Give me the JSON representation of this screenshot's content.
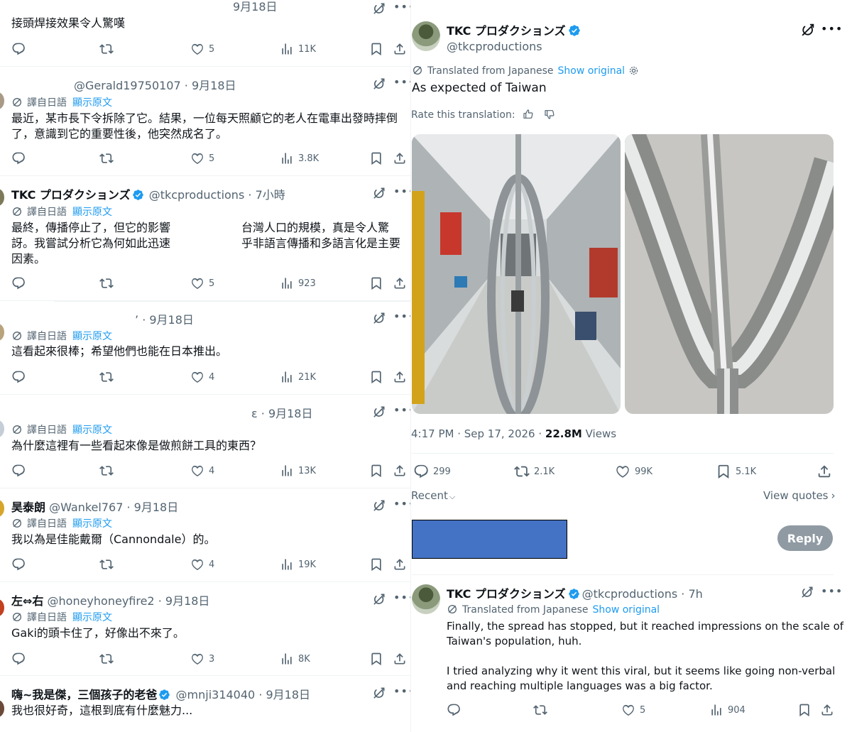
{
  "left": {
    "tweets": [
      {
        "date_fragment": "9月18日",
        "text": "接頭焊接效果令人驚嘆",
        "likes": "5",
        "views": "11K"
      },
      {
        "handle": "@Gerald19750107",
        "sep": "·",
        "date": "9月18日",
        "translated_from": "譯自日語",
        "show_original": "顯示原文",
        "text": "最近，某市長下令拆除了它。結果，一位每天照顧它的老人在電車出發時摔倒\n了，意識到它的重要性後，他突然成名了。",
        "likes": "5",
        "views": "3.8K"
      },
      {
        "name": "TKC プロダクションズ",
        "handle": "@tkcproductions",
        "sep": "·",
        "date": "7小時",
        "translated_from": "譯自日語",
        "show_original": "顯示原文",
        "text_a": "最終，傳播停止了，但它的影響\n訝。我嘗試分析它為何如此迅速\n因素。",
        "text_b": "台灣人口的規模，真是令人驚\n乎非語言傳播和多語言化是主要",
        "likes": "5",
        "views": "923"
      },
      {
        "handle_fragment": "’",
        "sep": "·",
        "date": "9月18日",
        "translated_from": "譯自日語",
        "show_original": "顯示原文",
        "text": "這看起來很棒；希望他們也能在日本推出。",
        "likes": "4",
        "views": "21K"
      },
      {
        "handle_fragment": "ɛ",
        "sep": "·",
        "date": "9月18日",
        "translated_from": "譯自日語",
        "show_original": "顯示原文",
        "text": "為什麼這裡有一些看起來像是做煎餅工具的東西？",
        "likes": "4",
        "views": "13K"
      },
      {
        "name": "昊泰朗",
        "handle": "@Wankel767",
        "sep": "·",
        "date": "9月18日",
        "translated_from": "譯自日語",
        "show_original": "顯示原文",
        "text": "我以為是佳能戴爾（Cannondale）的。",
        "likes": "4",
        "views": "19K"
      },
      {
        "name": "左⇔右",
        "handle": "@honeyhoneyfire2",
        "sep": "·",
        "date": "9月18日",
        "translated_from": "譯自日語",
        "show_original": "顯示原文",
        "text": "Gaki的頭卡住了，好像出不來了。",
        "likes": "3",
        "views": "8K"
      },
      {
        "name": "嗨~我是傑，三個孩子的老爸",
        "handle": "@mnji314040",
        "sep": "·",
        "date": "9月18日",
        "text": "我也很好奇，這根到底有什麼魅力..."
      }
    ]
  },
  "right": {
    "main": {
      "name": "TKC プロダクションズ",
      "handle": "@tkcproductions",
      "translated_from": "Translated from Japanese",
      "show_original": "Show original",
      "text": "As expected of Taiwan",
      "rate_label": "Rate this translation:",
      "time": "4:17 PM · Sep 17, 2026 ·",
      "views_count": "22.8M",
      "views_label": "Views",
      "replies": "299",
      "reposts": "2.1K",
      "likes": "99K",
      "bookmarks": "5.1K",
      "sort_label": "Recent",
      "view_quotes": "View quotes",
      "reply_button": "Reply"
    },
    "reply": {
      "name": "TKC プロダクションズ",
      "handle": "@tkcproductions",
      "sep": "·",
      "date": "7h",
      "translated_from": "Translated from Japanese",
      "show_original": "Show original",
      "text": "Finally, the spread has stopped, but it reached impressions on the scale of\nTaiwan's population, huh.\n\nI tried analyzing why it went this viral, but it seems like going non-verbal\nand reaching multiple languages was a big factor.",
      "likes": "5",
      "views": "904"
    }
  },
  "colors": {
    "link": "#1d9bf0",
    "verified": "#1d9bf0",
    "muted": "#536471",
    "redaction": "#4472c4",
    "reply_disabled": "#8f9aa3"
  }
}
